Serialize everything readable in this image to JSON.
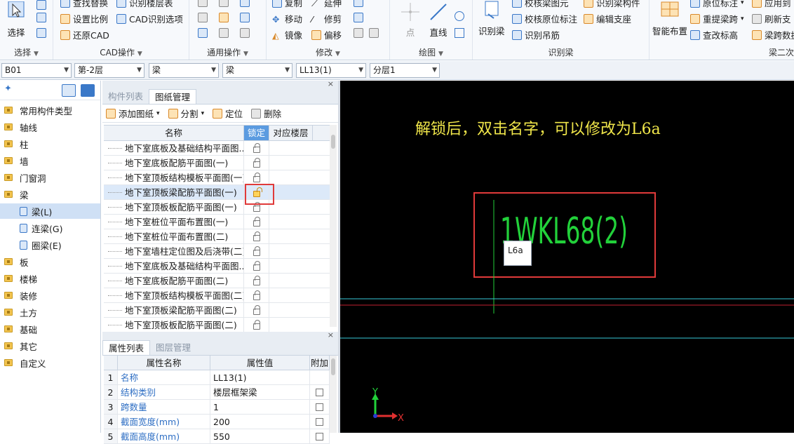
{
  "ribbon": {
    "select_group": {
      "big_button": "选择",
      "label": "选择"
    },
    "cad_group": {
      "items": [
        "查找替换",
        "识别楼层表",
        "设置比例",
        "CAD识别选项",
        "还原CAD"
      ],
      "label": "CAD操作"
    },
    "general_group": {
      "label": "通用操作"
    },
    "modify_group": {
      "items": [
        "复制",
        "延伸",
        "移动",
        "修剪",
        "镜像",
        "偏移"
      ],
      "label": "修改"
    },
    "draw_group": {
      "point": "点",
      "line": "直线",
      "label": "绘图"
    },
    "recognize_beam_group": {
      "big_button": "识别梁",
      "items": [
        "校核梁图元",
        "识别梁构件",
        "校核原位标注",
        "编辑支座",
        "识别吊筋"
      ],
      "label": "识别梁"
    },
    "secondary_beam_group": {
      "big_button": "智能布置",
      "items": [
        "原位标注",
        "应用到",
        "重提梁跨",
        "刷新支",
        "查改标高",
        "梁跨数据"
      ],
      "label": "梁二次"
    }
  },
  "selectors": [
    "B01",
    "第-2层",
    "梁",
    "梁",
    "LL13(1)",
    "分层1"
  ],
  "tree": {
    "items": [
      {
        "label": "常用构件类型",
        "type": "folder"
      },
      {
        "label": "轴线",
        "type": "folder"
      },
      {
        "label": "柱",
        "type": "folder"
      },
      {
        "label": "墙",
        "type": "folder"
      },
      {
        "label": "门窗洞",
        "type": "folder"
      },
      {
        "label": "梁",
        "type": "folder-open"
      },
      {
        "label": "梁(L)",
        "type": "child-selected"
      },
      {
        "label": "连梁(G)",
        "type": "child"
      },
      {
        "label": "圈梁(E)",
        "type": "child"
      },
      {
        "label": "板",
        "type": "folder"
      },
      {
        "label": "楼梯",
        "type": "folder"
      },
      {
        "label": "装修",
        "type": "folder"
      },
      {
        "label": "土方",
        "type": "folder"
      },
      {
        "label": "基础",
        "type": "folder"
      },
      {
        "label": "其它",
        "type": "folder"
      },
      {
        "label": "自定义",
        "type": "folder"
      }
    ]
  },
  "drawing_panel": {
    "tabs": [
      "构件列表",
      "图纸管理"
    ],
    "toolbar": {
      "add": "添加图纸",
      "split": "分割",
      "locate": "定位",
      "delete": "删除"
    },
    "columns": [
      "名称",
      "锁定",
      "对应楼层"
    ],
    "rows": [
      {
        "name": "地下室底板及基础结构平面图...",
        "locked": true
      },
      {
        "name": "地下室底板配筋平面图(一)",
        "locked": true
      },
      {
        "name": "地下室顶板结构模板平面图(一)",
        "locked": true
      },
      {
        "name": "地下室顶板梁配筋平面图(一)",
        "locked": false,
        "selected": true
      },
      {
        "name": "地下室顶板板配筋平面图(一)",
        "locked": true
      },
      {
        "name": "地下室桩位平面布置图(一)",
        "locked": true
      },
      {
        "name": "地下室桩位平面布置图(二)",
        "locked": true
      },
      {
        "name": "地下室墙柱定位图及后浇带(二)",
        "locked": true
      },
      {
        "name": "地下室底板及基础结构平面图...",
        "locked": true
      },
      {
        "name": "地下室底板配筋平面图(二)",
        "locked": true
      },
      {
        "name": "地下室顶板结构模板平面图(二)",
        "locked": true
      },
      {
        "name": "地下室顶板梁配筋平面图(二)",
        "locked": true
      },
      {
        "name": "地下室顶板板配筋平面图(二)",
        "locked": true
      }
    ]
  },
  "props_panel": {
    "tabs": [
      "属性列表",
      "图层管理"
    ],
    "columns": [
      "属性名称",
      "属性值",
      "附加"
    ],
    "rows": [
      {
        "n": "1",
        "key": "名称",
        "value": "LL13(1)",
        "attach": false
      },
      {
        "n": "2",
        "key": "结构类别",
        "value": "楼层框架梁",
        "attach": true
      },
      {
        "n": "3",
        "key": "跨数量",
        "value": "1",
        "attach": true
      },
      {
        "n": "4",
        "key": "截面宽度(mm)",
        "value": "200",
        "attach": true
      },
      {
        "n": "5",
        "key": "截面高度(mm)",
        "value": "550",
        "attach": true
      }
    ]
  },
  "canvas": {
    "annotation": "解锁后，双击名字，可以修改为L6a",
    "beam_label": "1WKL68(2)",
    "edit_box_text": "L6a",
    "axis_x": "X",
    "axis_y": "Y",
    "colors": {
      "annotation": "#f0e64a",
      "beam_label": "#22d13a",
      "highlight": "#e03a3a",
      "cyan_line": "#38c8d8",
      "red_line": "#c02030"
    }
  }
}
